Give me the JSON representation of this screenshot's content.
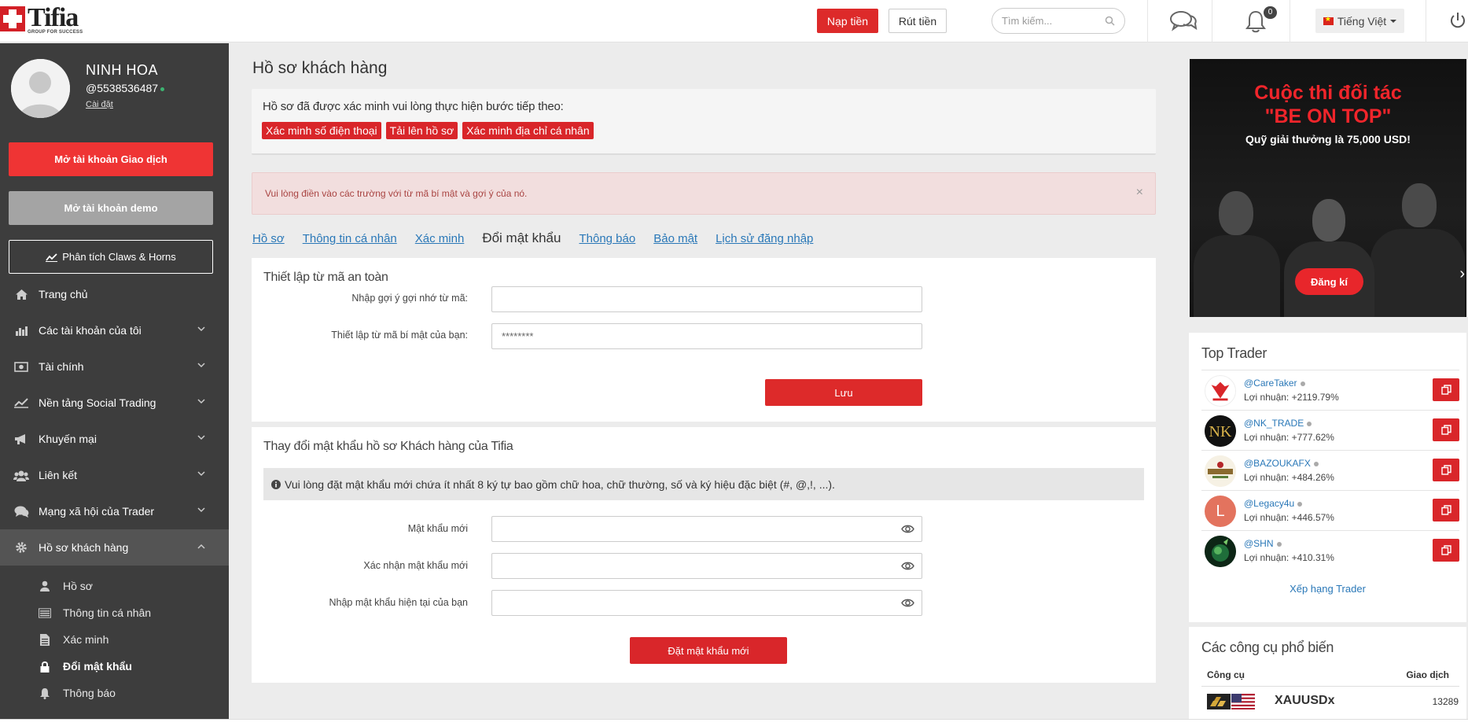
{
  "header": {
    "logo_text": "Tifia",
    "logo_tagline": "GROUP FOR SUCCESS",
    "deposit_label": "Nạp tiền",
    "withdraw_label": "Rút tiền",
    "search_placeholder": "Tìm kiếm...",
    "notification_count": "0",
    "language_label": "Tiếng Việt"
  },
  "sidebar": {
    "user_name": "NINH HOA",
    "user_id": "@5538536487",
    "settings_link": "Cài đặt",
    "open_trading_label": "Mở tài khoản Giao dịch",
    "open_demo_label": "Mở tài khoản demo",
    "analysis_label": "Phân tích Claws & Horns",
    "nav": [
      {
        "label": "Trang chủ",
        "icon": "home-icon"
      },
      {
        "label": "Các tài khoản của tôi",
        "icon": "bar-chart-icon"
      },
      {
        "label": "Tài chính",
        "icon": "money-icon"
      },
      {
        "label": "Nền tảng Social Trading",
        "icon": "line-chart-icon"
      },
      {
        "label": "Khuyến mại",
        "icon": "megaphone-icon"
      },
      {
        "label": "Liên kết",
        "icon": "users-icon"
      },
      {
        "label": "Mạng xã hội của Trader",
        "icon": "comments-icon"
      },
      {
        "label": "Hồ sơ khách hàng",
        "icon": "gear-icon"
      }
    ],
    "subnav": [
      {
        "label": "Hồ sơ",
        "icon": "user-icon"
      },
      {
        "label": "Thông tin cá nhân",
        "icon": "id-card-icon"
      },
      {
        "label": "Xác minh",
        "icon": "document-icon"
      },
      {
        "label": "Đổi mật khẩu",
        "icon": "lock-icon"
      },
      {
        "label": "Thông báo",
        "icon": "bell-icon"
      }
    ]
  },
  "main": {
    "title": "Hồ sơ khách hàng",
    "verify_text": "Hồ sơ đã được xác minh vui lòng thực hiện bước tiếp theo:",
    "verify_badges": [
      "Xác minh số điện thoại",
      "Tải lên hồ sơ",
      "Xác minh địa chỉ cá nhân"
    ],
    "alert_text": "Vui lòng điền vào các trường với từ mã bí mật và gợi ý của nó.",
    "alert_close": "×",
    "tabs": [
      "Hồ sơ",
      "Thông tin cá nhân",
      "Xác minh",
      "Đổi mật khẩu",
      "Thông báo",
      "Bảo mật",
      "Lịch sử đăng nhập"
    ],
    "codeword": {
      "title": "Thiết lập từ mã an toàn",
      "hint_label": "Nhập gợi ý gợi nhớ từ mã:",
      "hint_value": "",
      "code_label": "Thiết lập từ mã bí mật của bạn:",
      "code_placeholder": "********",
      "save_label": "Lưu"
    },
    "password": {
      "title": "Thay đổi mật khẩu hồ sơ Khách hàng của Tifia",
      "info_text": "Vui lòng đặt mật khẩu mới chứa ít nhất 8 ký tự bao gồm chữ hoa, chữ thường, số và ký hiệu đặc biệt (#, @,!, ...).",
      "new_label": "Mật khẩu mới",
      "confirm_label": "Xác nhận mật khẩu mới",
      "current_label": "Nhập mật khẩu hiện tại của bạn",
      "submit_label": "Đặt mật khẩu mới"
    }
  },
  "banner": {
    "headline_1": "Cuộc thi đối tác",
    "headline_2": "\"BE ON TOP\"",
    "subtitle": "Quỹ giải thưởng là 75,000 USD!",
    "button_label": "Đăng kí"
  },
  "top_trader": {
    "title": "Top Trader",
    "rows": [
      {
        "handle": "@CareTaker",
        "profit": "Lợi nhuận: +2119.79%",
        "avatar": "red-emblem"
      },
      {
        "handle": "@NK_TRADE",
        "profit": "Lợi nhuận: +777.62%",
        "avatar": "nk-logo"
      },
      {
        "handle": "@BAZOUKAFX",
        "profit": "Lợi nhuận: +484.26%",
        "avatar": "bazouka-logo"
      },
      {
        "handle": "@Legacy4u",
        "profit": "Lợi nhuận: +446.57%",
        "avatar": "L"
      },
      {
        "handle": "@SHN",
        "profit": "Lợi nhuận: +410.31%",
        "avatar": "globe"
      }
    ],
    "rank_link": "Xếp hạng Trader"
  },
  "tools": {
    "title": "Các công cụ phổ biến",
    "col_instrument": "Công cụ",
    "col_trades": "Giao dịch",
    "rows": [
      {
        "name": "XAUUSDx",
        "value": "13289"
      }
    ]
  },
  "colors": {
    "accent_red": "#dd2a2a",
    "sidebar_bg": "#3d3d3d",
    "link_blue": "#2a78b8"
  }
}
